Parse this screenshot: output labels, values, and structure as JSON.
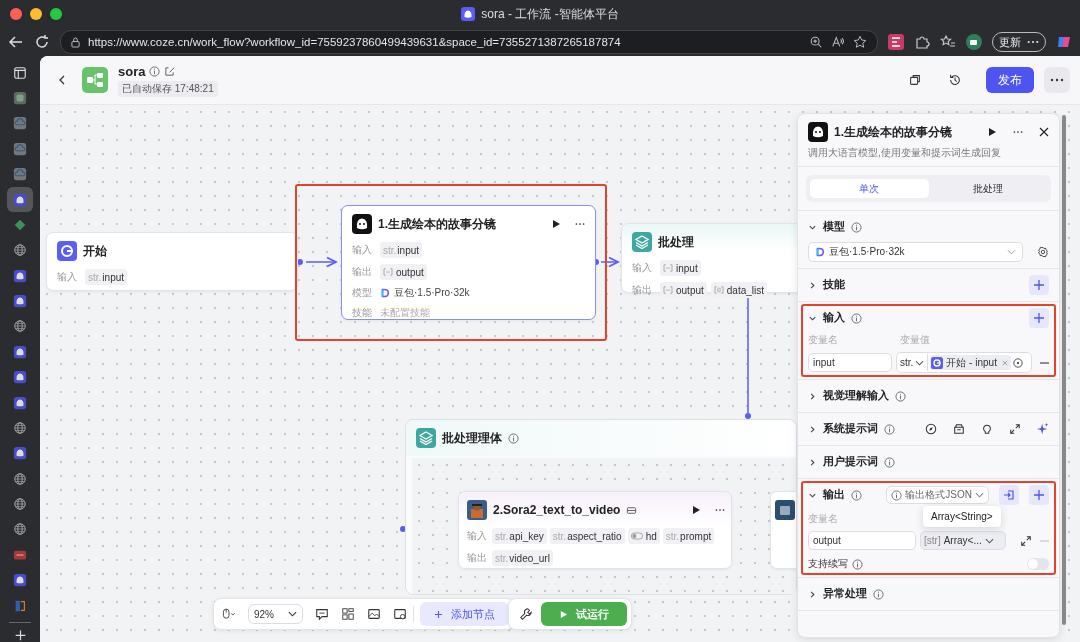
{
  "browser": {
    "title": "sora - 工作流 -智能体平台",
    "url": "https://www.coze.cn/work_flow?workflow_id=7559237860499439631&space_id=7355271387265187874",
    "update_button": "更新"
  },
  "sidebar_tabs": [
    {
      "kind": "tabs",
      "selected": false
    },
    {
      "kind": "app",
      "selected": false
    },
    {
      "kind": "cloud",
      "selected": false
    },
    {
      "kind": "cloud",
      "selected": false
    },
    {
      "kind": "cloud",
      "selected": false
    },
    {
      "kind": "bot",
      "selected": true
    },
    {
      "kind": "diamond",
      "selected": false
    },
    {
      "kind": "globe",
      "selected": false
    },
    {
      "kind": "bot",
      "selected": false
    },
    {
      "kind": "bot",
      "selected": false
    },
    {
      "kind": "globe",
      "selected": false
    },
    {
      "kind": "bot",
      "selected": false
    },
    {
      "kind": "bot",
      "selected": false
    },
    {
      "kind": "bot",
      "selected": false
    },
    {
      "kind": "globe",
      "selected": false
    },
    {
      "kind": "bot",
      "selected": false
    },
    {
      "kind": "globe",
      "selected": false
    },
    {
      "kind": "globe",
      "selected": false
    },
    {
      "kind": "globe",
      "selected": false
    },
    {
      "kind": "red",
      "selected": false
    },
    {
      "kind": "bot",
      "selected": false
    },
    {
      "kind": "book",
      "selected": false
    }
  ],
  "header": {
    "title": "sora",
    "saved": "已自动保存 17:48:21",
    "publish_button": "发布"
  },
  "canvas": {
    "start": {
      "title": "开始",
      "rows": [
        {
          "kind": "ports",
          "label": "输入",
          "chips": [
            {
              "kind": "string",
              "prefix": "str.",
              "name": "input"
            }
          ]
        }
      ]
    },
    "llm": {
      "title": "1.生成绘本的故事分镜",
      "highlighted": true,
      "rows": [
        {
          "kind": "ports",
          "label": "输入",
          "chips": [
            {
              "kind": "string",
              "prefix": "str.",
              "name": "input"
            }
          ]
        },
        {
          "kind": "ports",
          "label": "输出",
          "chips": [
            {
              "kind": "array",
              "name": "output"
            }
          ]
        },
        {
          "kind": "model",
          "label": "模型",
          "text": "豆包·1.5·Pro·32k"
        },
        {
          "kind": "note",
          "label": "技能",
          "text": "未配置技能"
        }
      ]
    },
    "batch": {
      "title": "批处理",
      "rows": [
        {
          "kind": "ports",
          "label": "输入",
          "chips": [
            {
              "kind": "array",
              "name": "input"
            }
          ]
        },
        {
          "kind": "ports",
          "label": "输出",
          "chips": [
            {
              "kind": "array",
              "name": "output"
            },
            {
              "kind": "object",
              "name": "data_list"
            }
          ]
        }
      ]
    },
    "batch_body": {
      "title": "批处理理体"
    },
    "inner": {
      "title": "2.Sora2_text_to_video",
      "rows": [
        {
          "kind": "ports",
          "label": "输入",
          "chips": [
            {
              "kind": "string",
              "prefix": "str.",
              "name": "api_key"
            },
            {
              "kind": "string",
              "prefix": "str.",
              "name": "aspect_ratio"
            },
            {
              "kind": "boolean",
              "name": "hd"
            },
            {
              "kind": "string",
              "prefix": "str.",
              "name": "prompt"
            }
          ]
        },
        {
          "kind": "ports",
          "label": "输出",
          "chips": [
            {
              "kind": "string",
              "prefix": "str.",
              "name": "video_url"
            }
          ]
        }
      ]
    }
  },
  "toolbar": {
    "zoom": "92%",
    "add_node": "添加节点",
    "run": "试运行"
  },
  "panel": {
    "title": "1.生成绘本的故事分镜",
    "description": "调用大语言模型,使用变量和提示词生成回复",
    "tabs": [
      {
        "label": "单次",
        "selected": true
      },
      {
        "label": "批处理",
        "selected": false
      }
    ],
    "sections": [
      {
        "kind": "model",
        "title": "模型",
        "expanded": true,
        "info": true,
        "add_button": false,
        "model": "豆包·1.5·Pro·32k"
      },
      {
        "kind": "plain",
        "title": "技能",
        "expanded": false,
        "info": false,
        "add_button": true
      },
      {
        "kind": "inputs",
        "title": "输入",
        "expanded": true,
        "info": true,
        "add_button": true,
        "highlighted": true,
        "name_header": "变量名",
        "value_header": "变量值",
        "rows": [
          {
            "name": "input",
            "type": "str.",
            "ref": "开始 - input"
          }
        ]
      },
      {
        "kind": "plain",
        "title": "视觉理解输入",
        "expanded": false,
        "info": true,
        "add_button": false
      },
      {
        "kind": "prompt",
        "title": "系统提示词",
        "expanded": false,
        "info": true,
        "add_button": false
      },
      {
        "kind": "plain",
        "title": "用户提示词",
        "expanded": false,
        "info": true,
        "add_button": false
      },
      {
        "kind": "outputs",
        "title": "输出",
        "expanded": true,
        "info": true,
        "add_button": true,
        "highlighted": true,
        "format": "输出格式JSON",
        "name_header": "变量名",
        "rows": [
          {
            "name": "output",
            "type_prefix": "[str]",
            "type": "Array<..."
          }
        ],
        "tooltip": "Array<String>",
        "continue_label": "支持续写",
        "continue_on": false
      },
      {
        "kind": "plain",
        "title": "异常处理",
        "expanded": false,
        "info": true,
        "add_button": false
      }
    ]
  }
}
